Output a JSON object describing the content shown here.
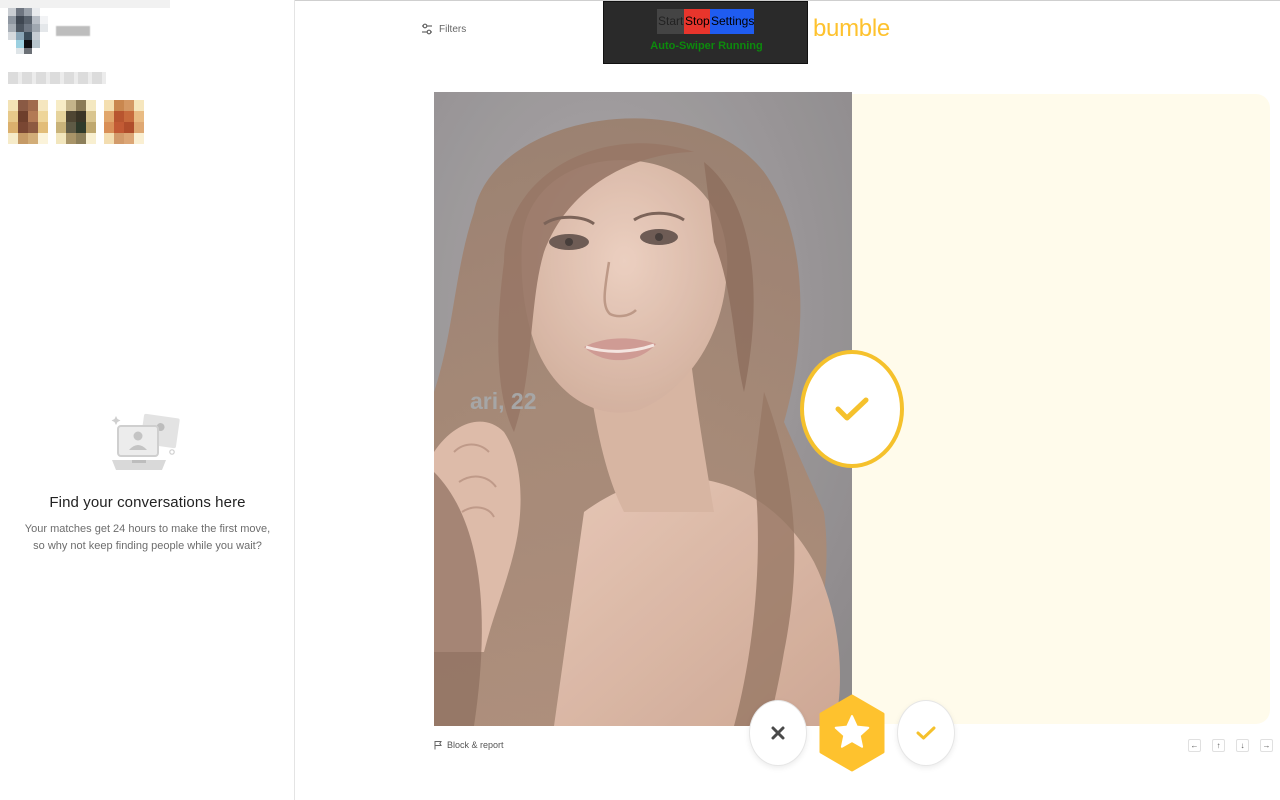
{
  "header": {
    "filters_label": "Filters",
    "brand": "bumble",
    "brand_color": "#fec22e"
  },
  "auto_swiper": {
    "start_label": "Start",
    "stop_label": "Stop",
    "settings_label": "Settings",
    "status": "Auto-Swiper Running",
    "colors": {
      "panel": "#2a2a2a",
      "start": "#444444",
      "stop": "#e8352c",
      "settings": "#1f5cf0",
      "status": "#0c8a0c"
    }
  },
  "sidebar": {
    "empty_state": {
      "title": "Find your conversations here",
      "body": "Your matches get 24 hours to make the first move, so why not keep finding people while you wait?"
    }
  },
  "profile": {
    "name_age": "ari, 22",
    "like_stamp_icon": "checkmark-icon"
  },
  "actions": {
    "block_report": "Block & report",
    "pass_icon": "close-icon",
    "superswipe_icon": "star-icon",
    "like_icon": "checkmark-icon"
  },
  "keyboard_hints": [
    "←",
    "↑",
    "↓",
    "→"
  ]
}
